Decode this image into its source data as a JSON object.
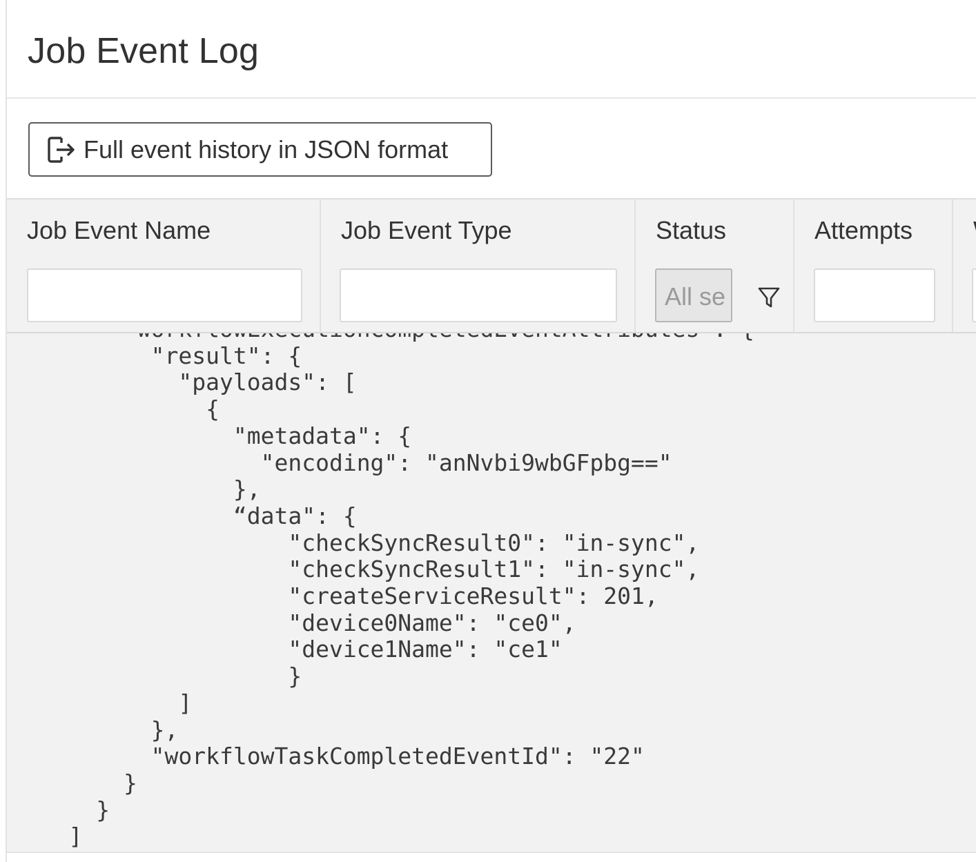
{
  "page": {
    "title": "Job Event Log"
  },
  "toolbar": {
    "json_button_label": "Full event history in JSON format",
    "json_button_icon": "export-icon"
  },
  "table": {
    "columns": [
      {
        "label": "Job Event Name",
        "filter_value": ""
      },
      {
        "label": "Job Event Type",
        "filter_value": ""
      },
      {
        "label": "Status",
        "filter_value": "All se"
      },
      {
        "label": "Attempts",
        "filter_value": ""
      },
      {
        "label": "W",
        "filter_value": ""
      }
    ],
    "status_filter_icon": "filter-icon"
  },
  "json_view": {
    "text": "        \"workflowExecutionCompletedEventAttributes\": {\n          \"result\": {\n            \"payloads\": [\n              {\n                \"metadata\": {\n                  \"encoding\": \"anNvbi9wbGFpbg==\"\n                },\n                “data\": {\n                    \"checkSyncResult0\": \"in-sync\",\n                    \"checkSyncResult1\": \"in-sync\",\n                    \"createServiceResult\": 201,\n                    \"device0Name\": \"ce0\",\n                    \"device1Name\": \"ce1\"\n                    }\n            ]\n          },\n          \"workflowTaskCompletedEventId\": \"22\"\n        }\n      }\n    ]"
  },
  "colors": {
    "header_bg": "#f2f2f2",
    "border": "#dadada",
    "text": "#333333"
  }
}
